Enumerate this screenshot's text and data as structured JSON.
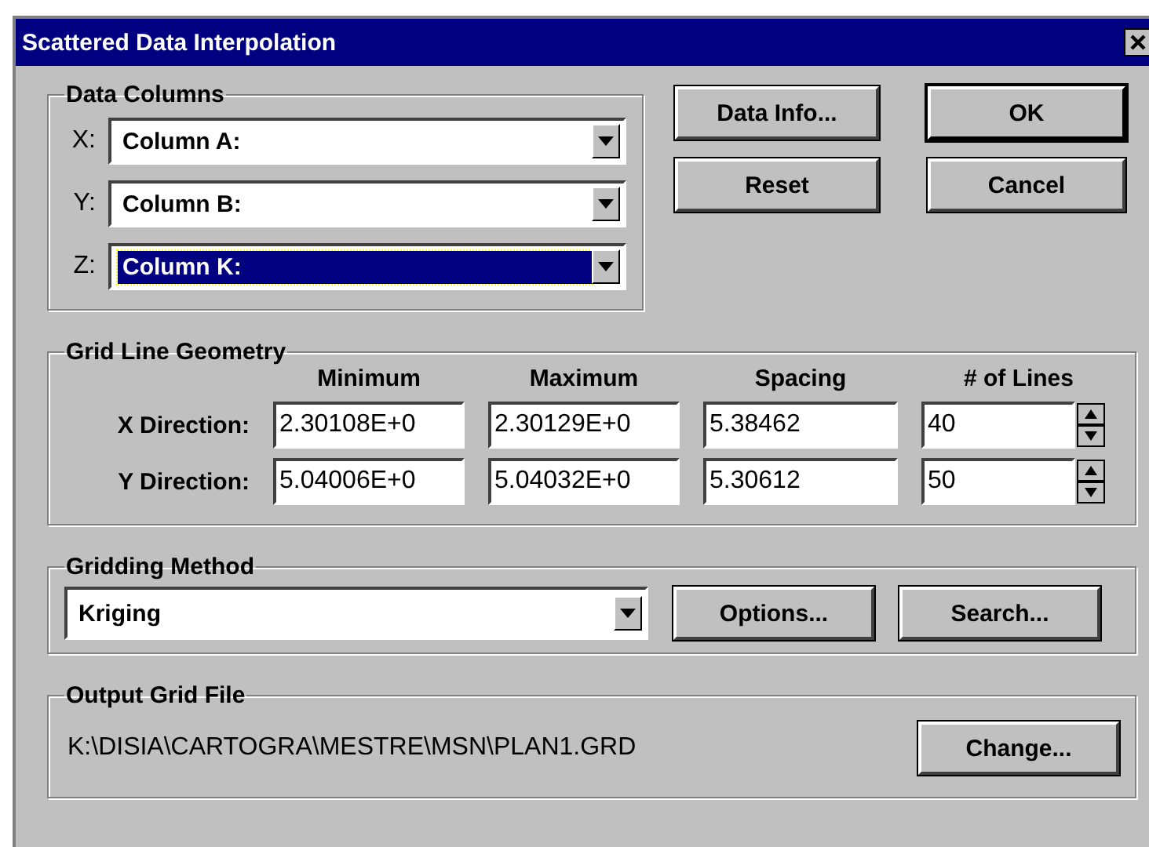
{
  "window": {
    "title": "Scattered Data Interpolation"
  },
  "data_columns": {
    "label": "Data Columns",
    "rows": [
      {
        "axis": "X:",
        "value": "Column A:",
        "selected": false
      },
      {
        "axis": "Y:",
        "value": "Column B:",
        "selected": false
      },
      {
        "axis": "Z:",
        "value": "Column K:",
        "selected": true
      }
    ]
  },
  "buttons": [
    {
      "label": "Data Info...",
      "default": false
    },
    {
      "label": "OK",
      "default": true
    },
    {
      "label": "Reset",
      "default": false
    },
    {
      "label": "Cancel",
      "default": false
    }
  ],
  "grid_line_geometry": {
    "label": "Grid Line Geometry",
    "columns": [
      "Minimum",
      "Maximum",
      "Spacing",
      "# of Lines"
    ],
    "rows": [
      {
        "label": "X Direction:",
        "values": [
          "2.30108E+0",
          "2.30129E+0",
          "5.38462",
          "40"
        ]
      },
      {
        "label": "Y Direction:",
        "values": [
          "5.04006E+0",
          "5.04032E+0",
          "5.30612",
          "50"
        ]
      }
    ]
  },
  "gridding_method": {
    "label": "Gridding Method",
    "value": "Kriging",
    "buttons": [
      "Options...",
      "Search..."
    ]
  },
  "output_grid_file": {
    "label": "Output Grid File",
    "path": "K:\\DISIA\\CARTOGRA\\MESTRE\\MSN\\PLAN1.GRD",
    "button": "Change..."
  }
}
